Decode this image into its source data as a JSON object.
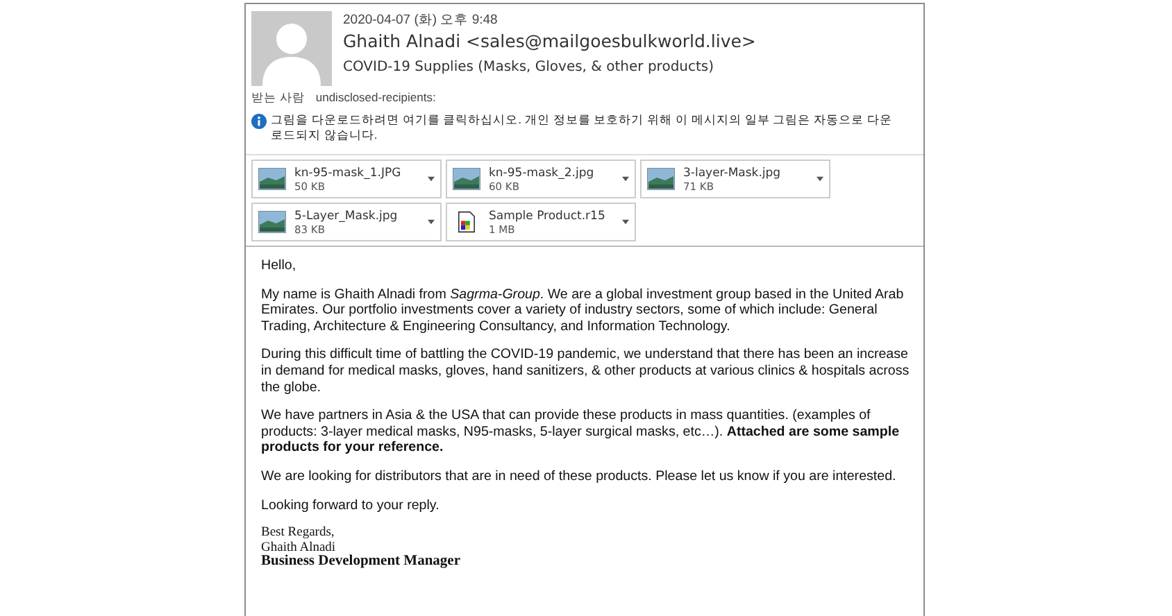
{
  "header": {
    "date": "2020-04-07 (화) 오후 9:48",
    "sender": "Ghaith Alnadi <sales@mailgoesbulkworld.live>",
    "subject": "COVID-19 Supplies (Masks, Gloves, & other products)",
    "to_label": "받는 사람",
    "to": "undisclosed-recipients:",
    "info": "그림을 다운로드하려면 여기를 클릭하십시오. 개인 정보를 보호하기 위해 이 메시지의 일부 그림은 자동으로 다운로드되지 않습니다."
  },
  "attachments": [
    {
      "name": "kn-95-mask_1.JPG",
      "size": "50 KB",
      "kind": "image"
    },
    {
      "name": "kn-95-mask_2.jpg",
      "size": "60 KB",
      "kind": "image"
    },
    {
      "name": "3-layer-Mask.jpg",
      "size": "71 KB",
      "kind": "image"
    },
    {
      "name": "5-Layer_Mask.jpg",
      "size": "83 KB",
      "kind": "image"
    },
    {
      "name": "Sample Product.r15",
      "size": "1 MB",
      "kind": "file"
    }
  ],
  "body": {
    "paragraphs": [
      "Hello,",
      "My name is Ghaith Alnadi from *Sagrma-Group*. We are a global investment group based in the United Arab Emirates. Our portfolio investments cover a variety of industry sectors, some of which include: General Trading, Architecture & Engineering Consultancy, and Information Technology.",
      "During this difficult time of battling the COVID-19 pandemic, we understand that there has been an increase in demand for medical masks, gloves, hand sanitizers, & other products at various clinics & hospitals across the globe.",
      "We have partners in Asia & the USA that can provide these products in mass quantities. (examples of products: 3-layer medical masks, N95-masks, 5-layer surgical masks, etc…). **Attached are some sample products for your reference.**",
      "We are looking for distributors that are in need of these products. Please let us know if you are interested.",
      "Looking forward to your reply."
    ],
    "signature": [
      {
        "text": "Best Regards,",
        "bold": false
      },
      {
        "text": "Ghaith Alnadi",
        "bold": false
      },
      {
        "text": "Business Development Manager",
        "bold": true
      }
    ]
  }
}
